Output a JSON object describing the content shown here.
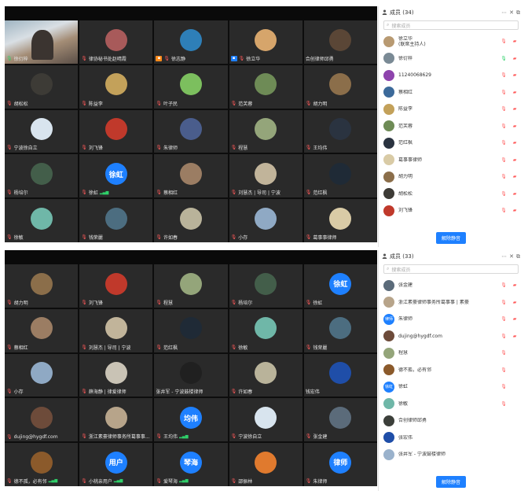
{
  "screens": [
    {
      "panel": {
        "title": "成员 (34)",
        "search_placeholder": "搜索成员",
        "unmute_all": "解除静音",
        "members": [
          {
            "name": "徐立华\n(联席主持人)",
            "mic": "muted",
            "cam": "off",
            "color": "#b89a72"
          },
          {
            "name": "徐衍梓",
            "mic": "on",
            "cam": "off",
            "color": "#7a8a95"
          },
          {
            "name": "11240068629",
            "mic": "muted",
            "cam": "off",
            "color": "#8e44ad"
          },
          {
            "name": "蔡相红",
            "mic": "muted",
            "cam": "off",
            "color": "#3c6a9a"
          },
          {
            "name": "陈益李",
            "mic": "muted",
            "cam": "off",
            "color": "#c3a15a"
          },
          {
            "name": "范芙蓉",
            "mic": "muted",
            "cam": "off",
            "color": "#6e8b56"
          },
          {
            "name": "范红枫",
            "mic": "muted",
            "cam": "off",
            "color": "#2a3340"
          },
          {
            "name": "葛事事律师",
            "mic": "muted",
            "cam": "off",
            "color": "#d9cba6"
          },
          {
            "name": "胡力明",
            "mic": "muted",
            "cam": "off",
            "color": "#8b6e4a"
          },
          {
            "name": "胡松松",
            "mic": "muted",
            "cam": "off",
            "color": "#3d3b36"
          },
          {
            "name": "刘飞锋",
            "mic": "muted",
            "cam": "off",
            "color": "#c0392b"
          }
        ]
      },
      "tiles": [
        {
          "label": "徐衍梓",
          "kind": "camera",
          "active": true,
          "mic": "on"
        },
        {
          "label": "律协秘书处赵晴霞",
          "kind": "avatar",
          "color": "#a85a5a",
          "mic": "muted"
        },
        {
          "label": "徐志静",
          "kind": "avatar",
          "color": "#2e7fb8",
          "mic": "muted",
          "badge": "host"
        },
        {
          "label": "徐立华",
          "kind": "avatar",
          "color": "#d6a56b",
          "mic": "muted",
          "badge": "cohost"
        },
        {
          "label": "合创律师邱勇",
          "kind": "avatar",
          "color": "#5a4636"
        },
        {
          "label": "胡松松",
          "kind": "avatar",
          "color": "#3d3b36",
          "mic": "muted"
        },
        {
          "label": "陈益李",
          "kind": "avatar",
          "color": "#c3a15a",
          "mic": "muted"
        },
        {
          "label": "叶子民",
          "kind": "avatar",
          "color": "#7cbf5e",
          "mic": "muted"
        },
        {
          "label": "范芙蓉",
          "kind": "avatar",
          "color": "#6e8b56",
          "mic": "muted"
        },
        {
          "label": "胡力明",
          "kind": "avatar",
          "color": "#8b6e4a",
          "mic": "muted"
        },
        {
          "label": "宁波徐自立",
          "kind": "avatar",
          "color": "#d8e4ee",
          "mic": "muted"
        },
        {
          "label": "刘飞锋",
          "kind": "avatar",
          "color": "#c0392b",
          "mic": "muted"
        },
        {
          "label": "朱律师",
          "kind": "avatar",
          "color": "#4a5d8c",
          "mic": "muted"
        },
        {
          "label": "程慧",
          "kind": "avatar",
          "color": "#94a57a",
          "mic": "muted"
        },
        {
          "label": "王均伟",
          "kind": "avatar",
          "color": "#2a3340",
          "mic": "muted"
        },
        {
          "label": "杨培尔",
          "kind": "avatar",
          "color": "#435e4a",
          "mic": "muted"
        },
        {
          "label": "徐虹",
          "kind": "text",
          "text": "徐虹",
          "mic": "muted",
          "signal": true
        },
        {
          "label": "蔡相红",
          "kind": "avatar",
          "color": "#9b7d63",
          "mic": "muted"
        },
        {
          "label": "刘慧杰 | 导司 | 宁波",
          "kind": "avatar",
          "color": "#c1b49a",
          "mic": "muted"
        },
        {
          "label": "范红枫",
          "kind": "avatar",
          "color": "#1f2a36",
          "mic": "muted"
        },
        {
          "label": "徐敏",
          "kind": "avatar",
          "color": "#6fb7a8",
          "mic": "muted"
        },
        {
          "label": "钱荣麗",
          "kind": "avatar",
          "color": "#4c6d80",
          "mic": "muted"
        },
        {
          "label": "许如春",
          "kind": "avatar",
          "color": "#b9b39a",
          "mic": "muted"
        },
        {
          "label": "小存",
          "kind": "avatar",
          "color": "#8fa9c4",
          "mic": "muted"
        },
        {
          "label": "葛事事律师",
          "kind": "avatar",
          "color": "#d9cba6",
          "mic": "muted"
        }
      ]
    },
    {
      "panel": {
        "title": "成员 (33)",
        "search_placeholder": "搜索成员",
        "unmute_all": "解除静音",
        "members": [
          {
            "name": "张金建",
            "mic": "muted",
            "cam": "off",
            "color": "#5b6b7a"
          },
          {
            "name": "浙江素豪律师事务所葛事事 | 素豪",
            "mic": "muted",
            "cam": "off",
            "color": "#b7a48a"
          },
          {
            "name": "朱律师",
            "mic": "muted",
            "cam": "off",
            "color": "#1e80ff",
            "text": "律师"
          },
          {
            "name": "dujing@hygdf.com",
            "mic": "muted",
            "cam": "off",
            "color": "#6d4b3a"
          },
          {
            "name": "程慧",
            "mic": "muted",
            "cam": "none",
            "color": "#94a57a"
          },
          {
            "name": "德不孤，必有邻",
            "mic": "muted",
            "cam": "none",
            "color": "#8b5a2b"
          },
          {
            "name": "徐虹",
            "mic": "muted",
            "cam": "none",
            "color": "#1e80ff",
            "text": "徐虹"
          },
          {
            "name": "徐敏",
            "mic": "muted",
            "cam": "none",
            "color": "#6fb7a8"
          },
          {
            "name": "合创律师邱勇",
            "mic": "none",
            "cam": "none",
            "color": "#3c3f3a"
          },
          {
            "name": "张宏伟",
            "mic": "none",
            "cam": "none",
            "color": "#1f4ea8"
          },
          {
            "name": "张井军 - 宁波鼓楼律师",
            "mic": "none",
            "cam": "none",
            "color": "#9ab2cc"
          }
        ]
      },
      "tiles": [
        {
          "label": "胡力明",
          "kind": "avatar",
          "color": "#8b6e4a",
          "mic": "muted"
        },
        {
          "label": "刘飞锋",
          "kind": "avatar",
          "color": "#c0392b",
          "mic": "muted"
        },
        {
          "label": "程慧",
          "kind": "avatar",
          "color": "#94a57a",
          "mic": "muted"
        },
        {
          "label": "杨培尔",
          "kind": "avatar",
          "color": "#435e4a",
          "mic": "muted"
        },
        {
          "label": "徐虹",
          "kind": "text",
          "text": "徐虹",
          "mic": "muted"
        },
        {
          "label": "蔡相红",
          "kind": "avatar",
          "color": "#9b7d63",
          "mic": "muted"
        },
        {
          "label": "刘慧杰 | 导司 | 宁波",
          "kind": "avatar",
          "color": "#c1b49a",
          "mic": "muted"
        },
        {
          "label": "范红枫",
          "kind": "avatar",
          "color": "#1f2a36",
          "mic": "muted"
        },
        {
          "label": "徐敏",
          "kind": "avatar",
          "color": "#6fb7a8",
          "mic": "muted"
        },
        {
          "label": "钱荣麗",
          "kind": "avatar",
          "color": "#4c6d80",
          "mic": "muted"
        },
        {
          "label": "小存",
          "kind": "avatar",
          "color": "#8fa9c4",
          "mic": "muted"
        },
        {
          "label": "薛海静 | 律爱律师",
          "kind": "avatar",
          "color": "#c9c3b5",
          "mic": "muted"
        },
        {
          "label": "张井军 - 宁波鼓楼律师",
          "kind": "avatar",
          "color": "#202020"
        },
        {
          "label": "许如春",
          "kind": "avatar",
          "color": "#b9b39a",
          "mic": "muted"
        },
        {
          "label": "钱宏伟",
          "kind": "avatar",
          "color": "#1f4ea8"
        },
        {
          "label": "dujing@hygdf.com",
          "kind": "avatar",
          "color": "#6d4b3a",
          "mic": "muted"
        },
        {
          "label": "浙江素豪律师事务所葛事事...",
          "kind": "avatar",
          "color": "#b7a48a",
          "mic": "muted"
        },
        {
          "label": "王均伟",
          "kind": "text",
          "text": "均伟",
          "mic": "muted",
          "signal": true
        },
        {
          "label": "宁波徐自立",
          "kind": "avatar",
          "color": "#d8e4ee",
          "mic": "muted"
        },
        {
          "label": "张金建",
          "kind": "avatar",
          "color": "#5b6b7a",
          "mic": "muted"
        },
        {
          "label": "德不孤，必有邻",
          "kind": "avatar",
          "color": "#8b5a2b",
          "mic": "muted",
          "signal": true
        },
        {
          "label": "小桃亲用户",
          "kind": "text",
          "text": "用户",
          "mic": "muted",
          "signal": true
        },
        {
          "label": "爱琴海",
          "kind": "text",
          "text": "琴海",
          "mic": "muted",
          "signal": true
        },
        {
          "label": "邵振林",
          "kind": "avatar",
          "color": "#e07a2e",
          "mic": "muted"
        },
        {
          "label": "朱律师",
          "kind": "text",
          "text": "律师",
          "mic": "muted"
        }
      ]
    }
  ]
}
